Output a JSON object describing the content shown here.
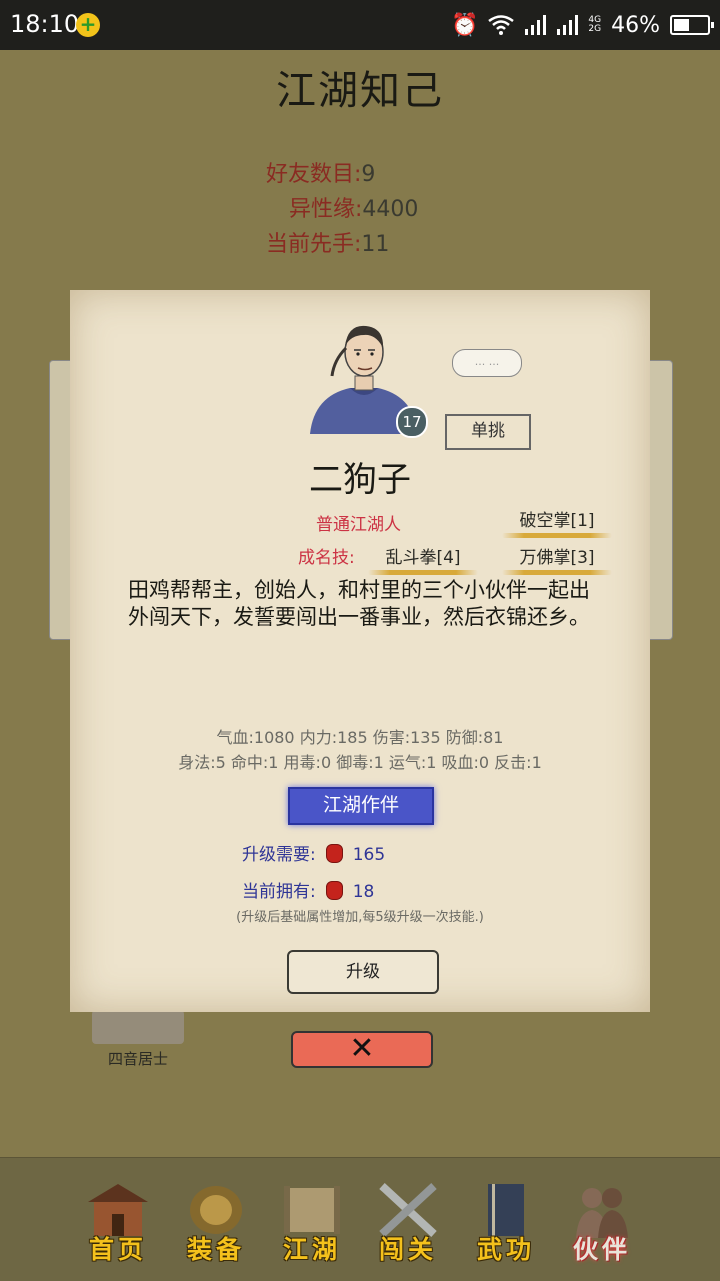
{
  "status_bar": {
    "time": "18:10",
    "network": "4G\n2G",
    "battery_text": "46%",
    "battery_level": 0.46
  },
  "header": {
    "title": "江湖知己"
  },
  "summary": {
    "friends_label": "好友数目:",
    "friends_value": "9",
    "opposite_sex_label": "异性缘:",
    "opposite_sex_value": "4400",
    "first_move_label": "当前先手:",
    "first_move_value": "11"
  },
  "background_list": {
    "item_name": "四音居士"
  },
  "character": {
    "bubble_text": "... ...",
    "level": "17",
    "duel_label": "单挑",
    "name": "二狗子",
    "title": "普通江湖人",
    "fame_skill_label": "成名技:",
    "skills": [
      "破空掌[1]",
      "乱斗拳[4]",
      "万佛掌[3]"
    ],
    "description": "田鸡帮帮主，创始人，和村里的三个小伙伴一起出外闯天下，发誓要闯出一番事业，然后衣锦还乡。",
    "attributes_line1": "气血:1080  内力:185  伤害:135  防御:81",
    "attributes_line2": "身法:5  命中:1  用毒:0  御毒:1  运气:1  吸血:0  反击:1",
    "partner_label": "江湖作伴",
    "upgrade_need_label": "升级需要:",
    "upgrade_need_value": "165",
    "owned_label": "当前拥有:",
    "owned_value": "18",
    "note": "(升级后基础属性增加,每5级升级一次技能.)",
    "upgrade_button": "升级"
  },
  "close_button": "✕",
  "tabs": [
    {
      "label": "首页",
      "icon": "house-icon"
    },
    {
      "label": "装备",
      "icon": "armor-icon"
    },
    {
      "label": "江湖",
      "icon": "scroll-icon"
    },
    {
      "label": "闯关",
      "icon": "swords-icon"
    },
    {
      "label": "武功",
      "icon": "book-icon"
    },
    {
      "label": "伙伴",
      "icon": "people-icon",
      "active": true
    }
  ]
}
